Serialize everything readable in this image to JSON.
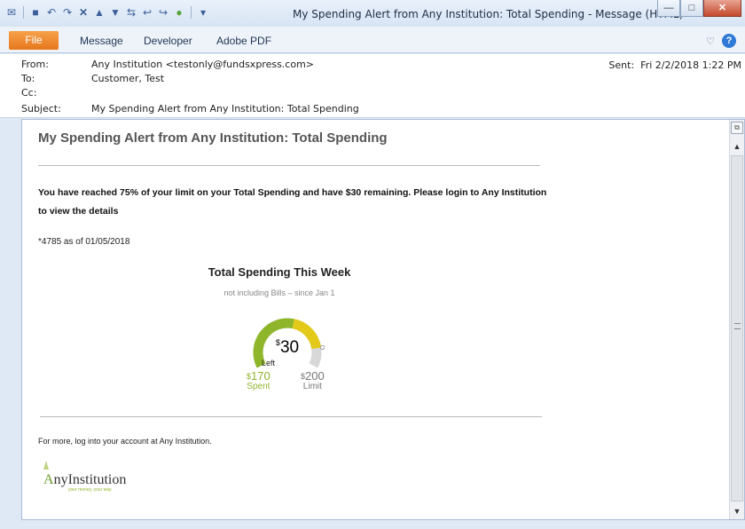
{
  "window": {
    "title": "My Spending Alert from Any Institution: Total Spending - Message (HTML)"
  },
  "ribbon": {
    "tabs": [
      "File",
      "Message",
      "Developer",
      "Adobe PDF"
    ]
  },
  "header": {
    "from_label": "From:",
    "from_value": "Any Institution <testonly@fundsxpress.com>",
    "to_label": "To:",
    "to_value": "Customer, Test",
    "cc_label": "Cc:",
    "cc_value": "",
    "subject_label": "Subject:",
    "subject_value": "My Spending Alert from Any Institution: Total Spending",
    "sent_label": "Sent:",
    "sent_value": "Fri 2/2/2018 1:22 PM"
  },
  "email": {
    "title": "My Spending Alert from Any Institution: Total Spending",
    "alert": "You have reached 75% of your limit on your Total Spending and have $30 remaining. Please login to Any Institution to view the details",
    "account_line": "*4785 as of 01/05/2018",
    "gauge": {
      "title": "Total Spending This Week",
      "subtitle": "not including Bills – since Jan 1",
      "left_amount": "30",
      "left_label": "Left",
      "spent_amount": "170",
      "spent_label": "Spent",
      "limit_amount": "200",
      "limit_label": "Limit",
      "spent_fraction": 0.85,
      "spent_color": "#8fb52b",
      "left_color": "#e3c91a",
      "track_color": "#d8d8d8"
    },
    "footer": "For more, log into your account at Any Institution.",
    "logo_text": "AnyInstitution",
    "logo_tagline": "your money, your way."
  }
}
